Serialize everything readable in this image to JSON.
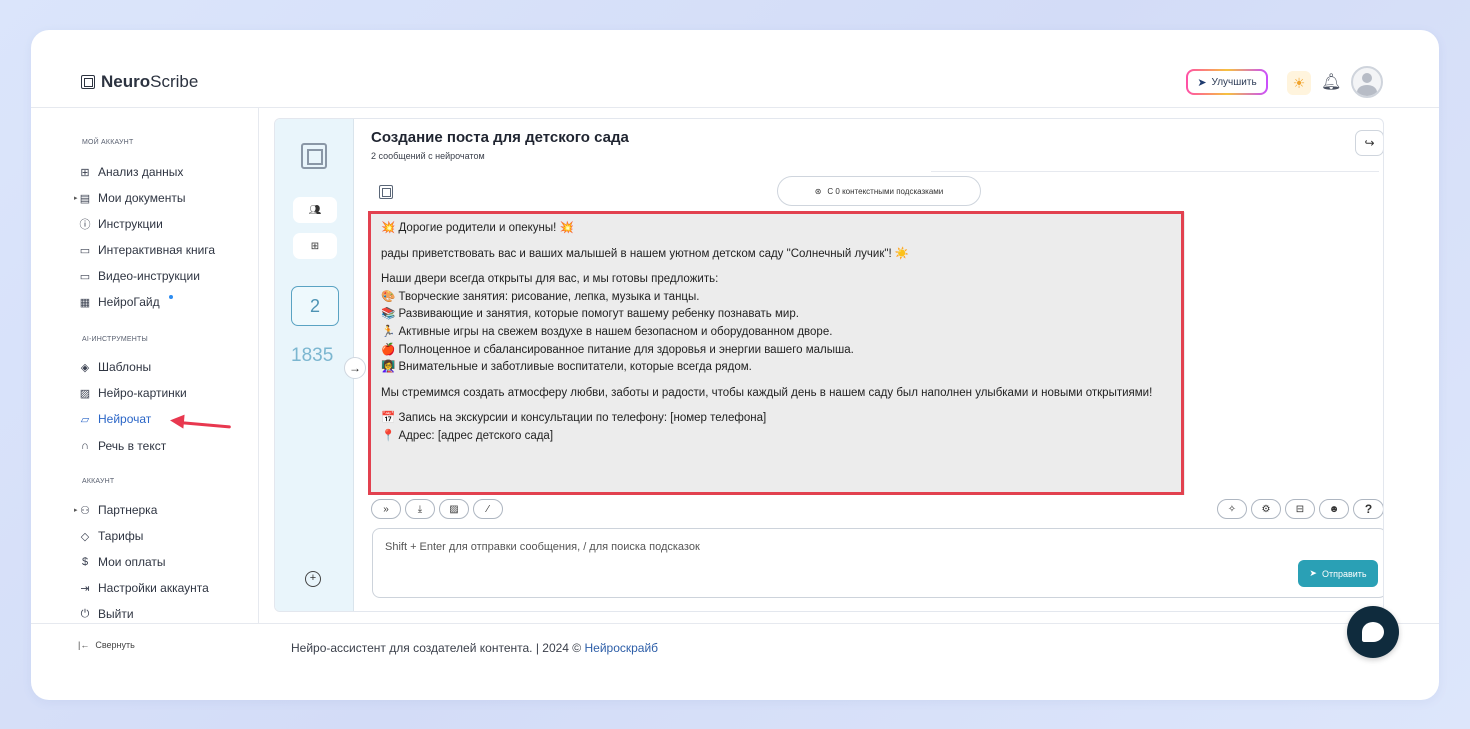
{
  "app": {
    "brand_bold": "Neuro",
    "brand_light": "Scribe"
  },
  "header": {
    "upgrade_label": "Улучшить",
    "icons": [
      "rocket-icon",
      "sun-icon",
      "bell-icon",
      "user-avatar"
    ]
  },
  "sidebar": {
    "section_account": "МОЙ АККАУНТ",
    "account_items": [
      {
        "label": "Анализ данных",
        "icon": "grid-icon"
      },
      {
        "label": "Мои документы",
        "icon": "document-icon"
      },
      {
        "label": "Инструкции",
        "icon": "question-icon"
      },
      {
        "label": "Интерактивная книга",
        "icon": "book-icon"
      },
      {
        "label": "Видео-инструкции",
        "icon": "video-icon"
      },
      {
        "label": "НейроГайд",
        "icon": "guide-icon"
      }
    ],
    "section_ai": "AI-ИНСТРУМЕНТЫ",
    "ai_items": [
      {
        "label": "Шаблоны",
        "icon": "layers-icon"
      },
      {
        "label": "Нейро-картинки",
        "icon": "image-icon"
      },
      {
        "label": "Нейрочат",
        "icon": "chat-icon"
      },
      {
        "label": "Речь в текст",
        "icon": "headphones-icon"
      }
    ],
    "section_akk": "АККАУНТ",
    "akk_items": [
      {
        "label": "Партнерка",
        "icon": "users-icon"
      },
      {
        "label": "Тарифы",
        "icon": "tag-icon"
      },
      {
        "label": "Мои оплаты",
        "icon": "dollar-icon"
      },
      {
        "label": "Настройки аккаунта",
        "icon": "settings-icon"
      },
      {
        "label": "Выйти",
        "icon": "power-icon"
      }
    ],
    "collapse_label": "Свернуть"
  },
  "chat": {
    "title": "Создание поста для детского сада",
    "subtitle": "2 сообщений с нейрочатом",
    "rail_count": "2",
    "rail_number": "1835",
    "context_label": "С 0 контекстными подсказками",
    "message": {
      "line1": "💥 Дорогие родители и опекуны! 💥",
      "line2": "рады приветствовать вас и ваших малышей в нашем уютном детском саду \"Солнечный лучик\"! ☀️",
      "line3": "Наши двери всегда открыты для вас, и мы готовы предложить:",
      "line4": "🎨 Творческие занятия: рисование, лепка, музыка и танцы.",
      "line5": "📚 Развивающие и занятия, которые помогут вашему ребенку познавать мир.",
      "line6": "🏃 Активные игры на свежем воздухе в нашем безопасном и оборудованном дворе.",
      "line7": "🍎 Полноценное и сбалансированное питание для здоровья и энергии вашего малыша.",
      "line8": "👩‍🏫 Внимательные и заботливые воспитатели, которые всегда рядом.",
      "line9": "Мы стремимся создать атмосферу любви, заботы и радости, чтобы каждый день в нашем саду был наполнен улыбками и новыми открытиями!",
      "line10": "📅 Запись на экскурсии и консультации по телефону: [номер телефона]",
      "line11": "📍 Адрес: [адрес детского сада]"
    },
    "input_placeholder": "Shift + Enter для отправки сообщения, / для поиска подсказок",
    "send_label": "Отправить",
    "help_label": "?"
  },
  "footer": {
    "text": "Нейро-ассистент для создателей контента.  | 2024 © ",
    "link": "Нейроскрайб"
  },
  "colors": {
    "accent": "#2b66c7",
    "send": "#2aa0b5",
    "highlight": "#e2414f",
    "rail_bg": "#e9f5fb"
  }
}
